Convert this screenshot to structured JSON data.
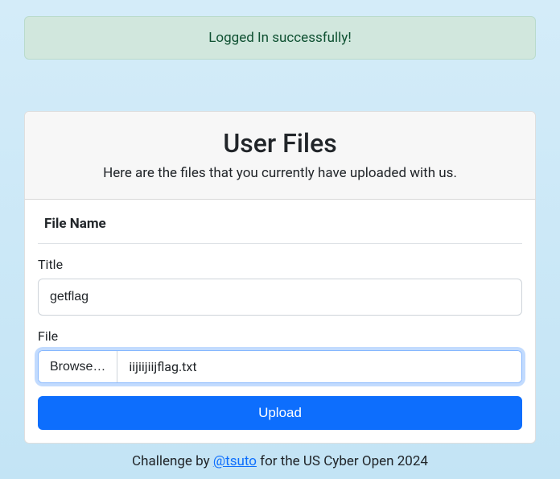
{
  "alert": {
    "message": "Logged In successfully!"
  },
  "card": {
    "title": "User Files",
    "subtitle": "Here are the files that you currently have uploaded with us."
  },
  "table": {
    "column_header": "File Name"
  },
  "form": {
    "title_label": "Title",
    "title_value": "getflag",
    "file_label": "File",
    "browse_label": "Browse…",
    "file_name": "iijiijiijflag.txt",
    "submit_label": "Upload"
  },
  "footer": {
    "prefix": "Challenge by ",
    "author": "@tsuto",
    "suffix": " for the US Cyber Open 2024"
  }
}
